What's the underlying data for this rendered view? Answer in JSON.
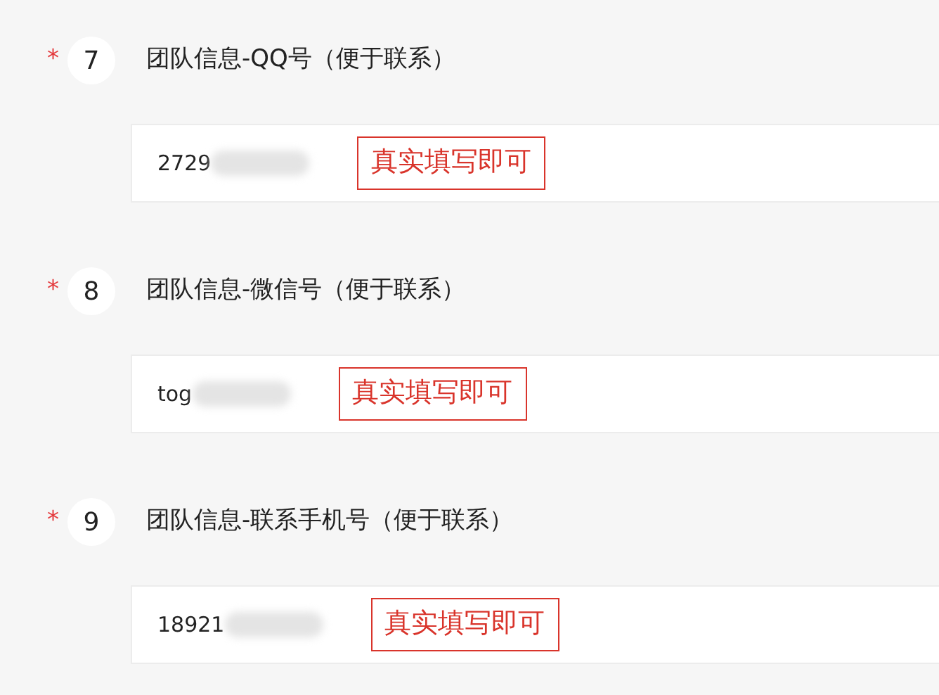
{
  "questions": [
    {
      "required_mark": "*",
      "number": "7",
      "title": "团队信息-QQ号（便于联系）",
      "value": "2729",
      "note": "真实填写即可"
    },
    {
      "required_mark": "*",
      "number": "8",
      "title": "团队信息-微信号（便于联系）",
      "value": "tog",
      "note": "真实填写即可"
    },
    {
      "required_mark": "*",
      "number": "9",
      "title": "团队信息-联系手机号（便于联系）",
      "value": "18921",
      "note": "真实填写即可"
    }
  ]
}
